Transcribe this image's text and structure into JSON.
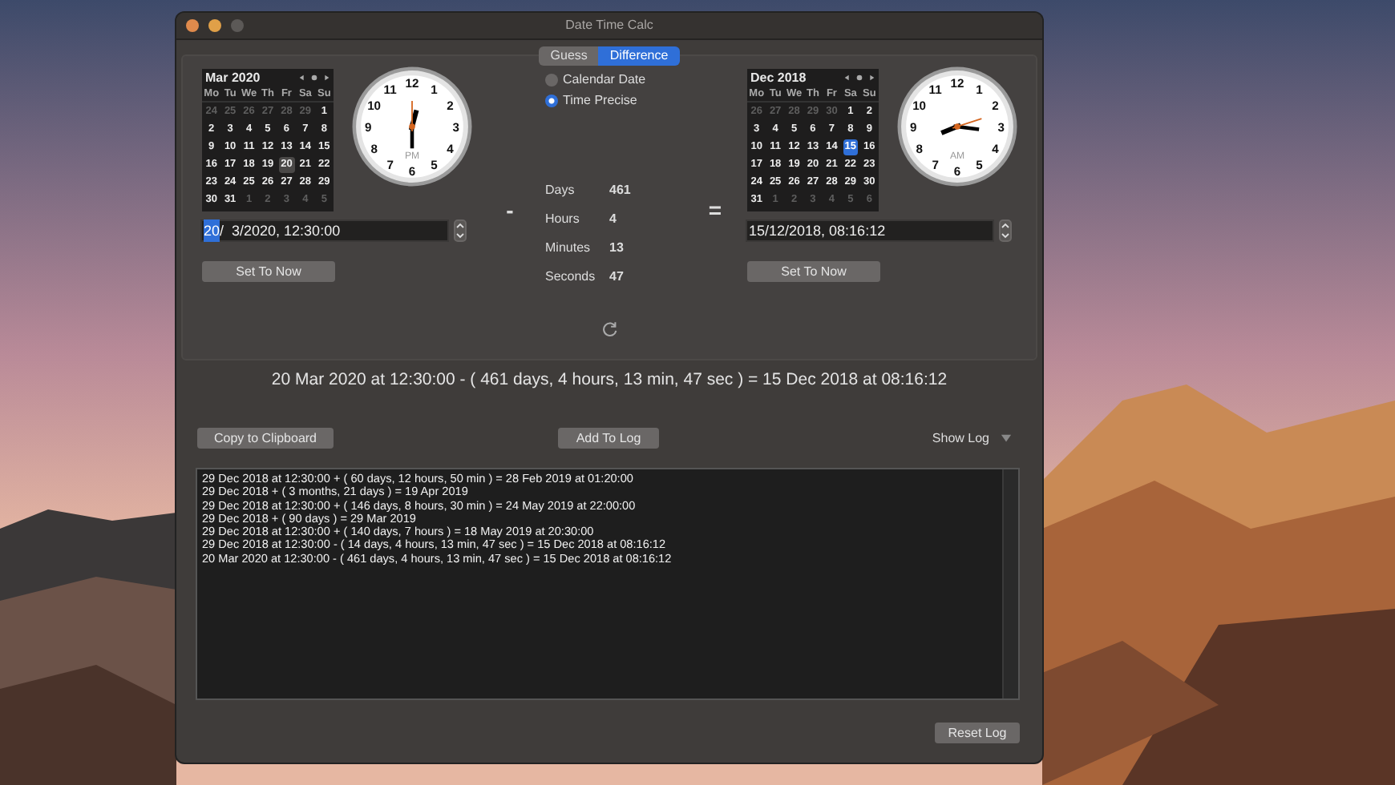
{
  "window": {
    "title": "Date Time Calc",
    "controls": [
      {
        "kind": "close",
        "disabled": false
      },
      {
        "kind": "minimize",
        "disabled": false
      },
      {
        "kind": "zoom",
        "disabled": true
      }
    ]
  },
  "tabs": [
    {
      "label": "Guess",
      "selected": false
    },
    {
      "label": "Difference",
      "selected": true
    }
  ],
  "dates": [
    {
      "calendar": {
        "title": "Mar 2020",
        "focused": false,
        "weekdays": [
          "Mo",
          "Tu",
          "We",
          "Th",
          "Fr",
          "Sa",
          "Su"
        ],
        "weeks": [
          [
            {
              "label": "24",
              "outside": true,
              "selected": false
            },
            {
              "label": "25",
              "outside": true,
              "selected": false
            },
            {
              "label": "26",
              "outside": true,
              "selected": false
            },
            {
              "label": "27",
              "outside": true,
              "selected": false
            },
            {
              "label": "28",
              "outside": true,
              "selected": false
            },
            {
              "label": "29",
              "outside": true,
              "selected": false
            },
            {
              "label": "1",
              "outside": false,
              "selected": false
            }
          ],
          [
            {
              "label": "2",
              "outside": false,
              "selected": false
            },
            {
              "label": "3",
              "outside": false,
              "selected": false
            },
            {
              "label": "4",
              "outside": false,
              "selected": false
            },
            {
              "label": "5",
              "outside": false,
              "selected": false
            },
            {
              "label": "6",
              "outside": false,
              "selected": false
            },
            {
              "label": "7",
              "outside": false,
              "selected": false
            },
            {
              "label": "8",
              "outside": false,
              "selected": false
            }
          ],
          [
            {
              "label": "9",
              "outside": false,
              "selected": false
            },
            {
              "label": "10",
              "outside": false,
              "selected": false
            },
            {
              "label": "11",
              "outside": false,
              "selected": false
            },
            {
              "label": "12",
              "outside": false,
              "selected": false
            },
            {
              "label": "13",
              "outside": false,
              "selected": false
            },
            {
              "label": "14",
              "outside": false,
              "selected": false
            },
            {
              "label": "15",
              "outside": false,
              "selected": false
            }
          ],
          [
            {
              "label": "16",
              "outside": false,
              "selected": false
            },
            {
              "label": "17",
              "outside": false,
              "selected": false
            },
            {
              "label": "18",
              "outside": false,
              "selected": false
            },
            {
              "label": "19",
              "outside": false,
              "selected": false
            },
            {
              "label": "20",
              "outside": false,
              "selected": true
            },
            {
              "label": "21",
              "outside": false,
              "selected": false
            },
            {
              "label": "22",
              "outside": false,
              "selected": false
            }
          ],
          [
            {
              "label": "23",
              "outside": false,
              "selected": false
            },
            {
              "label": "24",
              "outside": false,
              "selected": false
            },
            {
              "label": "25",
              "outside": false,
              "selected": false
            },
            {
              "label": "26",
              "outside": false,
              "selected": false
            },
            {
              "label": "27",
              "outside": false,
              "selected": false
            },
            {
              "label": "28",
              "outside": false,
              "selected": false
            },
            {
              "label": "29",
              "outside": false,
              "selected": false
            }
          ],
          [
            {
              "label": "30",
              "outside": false,
              "selected": false
            },
            {
              "label": "31",
              "outside": false,
              "selected": false
            },
            {
              "label": "1",
              "outside": true,
              "selected": false
            },
            {
              "label": "2",
              "outside": true,
              "selected": false
            },
            {
              "label": "3",
              "outside": true,
              "selected": false
            },
            {
              "label": "4",
              "outside": true,
              "selected": false
            },
            {
              "label": "5",
              "outside": true,
              "selected": false
            }
          ]
        ]
      },
      "clock": {
        "numerals": [
          "12",
          "11",
          "1",
          "10",
          "2",
          "9",
          "3",
          "8",
          "4",
          "7",
          "5",
          "6"
        ],
        "meridiem": "PM"
      },
      "field": {
        "segments": [
          {
            "text": "20",
            "selected": true
          },
          {
            "text": "/  3/2020, 12:30:00",
            "selected": false
          }
        ]
      },
      "button": "Set To Now"
    },
    {
      "calendar": {
        "title": "Dec 2018",
        "focused": true,
        "weekdays": [
          "Mo",
          "Tu",
          "We",
          "Th",
          "Fr",
          "Sa",
          "Su"
        ],
        "weeks": [
          [
            {
              "label": "26",
              "outside": true,
              "selected": false
            },
            {
              "label": "27",
              "outside": true,
              "selected": false
            },
            {
              "label": "28",
              "outside": true,
              "selected": false
            },
            {
              "label": "29",
              "outside": true,
              "selected": false
            },
            {
              "label": "30",
              "outside": true,
              "selected": false
            },
            {
              "label": "1",
              "outside": false,
              "selected": false
            },
            {
              "label": "2",
              "outside": false,
              "selected": false
            }
          ],
          [
            {
              "label": "3",
              "outside": false,
              "selected": false
            },
            {
              "label": "4",
              "outside": false,
              "selected": false
            },
            {
              "label": "5",
              "outside": false,
              "selected": false
            },
            {
              "label": "6",
              "outside": false,
              "selected": false
            },
            {
              "label": "7",
              "outside": false,
              "selected": false
            },
            {
              "label": "8",
              "outside": false,
              "selected": false
            },
            {
              "label": "9",
              "outside": false,
              "selected": false
            }
          ],
          [
            {
              "label": "10",
              "outside": false,
              "selected": false
            },
            {
              "label": "11",
              "outside": false,
              "selected": false
            },
            {
              "label": "12",
              "outside": false,
              "selected": false
            },
            {
              "label": "13",
              "outside": false,
              "selected": false
            },
            {
              "label": "14",
              "outside": false,
              "selected": false
            },
            {
              "label": "15",
              "outside": false,
              "selected": true
            },
            {
              "label": "16",
              "outside": false,
              "selected": false
            }
          ],
          [
            {
              "label": "17",
              "outside": false,
              "selected": false
            },
            {
              "label": "18",
              "outside": false,
              "selected": false
            },
            {
              "label": "19",
              "outside": false,
              "selected": false
            },
            {
              "label": "20",
              "outside": false,
              "selected": false
            },
            {
              "label": "21",
              "outside": false,
              "selected": false
            },
            {
              "label": "22",
              "outside": false,
              "selected": false
            },
            {
              "label": "23",
              "outside": false,
              "selected": false
            }
          ],
          [
            {
              "label": "24",
              "outside": false,
              "selected": false
            },
            {
              "label": "25",
              "outside": false,
              "selected": false
            },
            {
              "label": "26",
              "outside": false,
              "selected": false
            },
            {
              "label": "27",
              "outside": false,
              "selected": false
            },
            {
              "label": "28",
              "outside": false,
              "selected": false
            },
            {
              "label": "29",
              "outside": false,
              "selected": false
            },
            {
              "label": "30",
              "outside": false,
              "selected": false
            }
          ],
          [
            {
              "label": "31",
              "outside": false,
              "selected": false
            },
            {
              "label": "1",
              "outside": true,
              "selected": false
            },
            {
              "label": "2",
              "outside": true,
              "selected": false
            },
            {
              "label": "3",
              "outside": true,
              "selected": false
            },
            {
              "label": "4",
              "outside": true,
              "selected": false
            },
            {
              "label": "5",
              "outside": true,
              "selected": false
            },
            {
              "label": "6",
              "outside": true,
              "selected": false
            }
          ]
        ]
      },
      "clock": {
        "numerals": [
          "12",
          "11",
          "1",
          "10",
          "2",
          "9",
          "3",
          "8",
          "4",
          "7",
          "5",
          "6"
        ],
        "meridiem": "AM"
      },
      "field": {
        "segments": [
          {
            "text": "15/12/2018, 08:16:12",
            "selected": false
          }
        ]
      },
      "button": "Set To Now"
    }
  ],
  "modes": [
    {
      "label": "Calendar Date",
      "selected": false
    },
    {
      "label": "Time Precise",
      "selected": true
    }
  ],
  "operator": "-",
  "equals": "=",
  "difference": [
    {
      "label": "Days",
      "value": "461"
    },
    {
      "label": "Hours",
      "value": "4"
    },
    {
      "label": "Minutes",
      "value": "13"
    },
    {
      "label": "Seconds",
      "value": "47"
    }
  ],
  "result": "20 Mar 2020 at 12:30:00 - ( 461 days, 4 hours, 13 min, 47 sec ) = 15 Dec 2018 at 08:16:12",
  "copy_button": "Copy to Clipboard",
  "add_button": "Add To Log",
  "show_log": {
    "label": "Show Log",
    "expanded": true
  },
  "log": [
    "29 Dec 2018 at 12:30:00 + ( 60 days, 12 hours, 50 min ) = 28 Feb 2019 at 01:20:00",
    "29 Dec 2018 + ( 3 months, 21 days ) = 19 Apr 2019",
    "29 Dec 2018 at 12:30:00 + ( 146 days, 8 hours, 30 min ) = 24 May 2019 at 22:00:00",
    "29 Dec 2018 + ( 90 days ) = 29 Mar 2019",
    "29 Dec 2018 at 12:30:00 + ( 140 days, 7 hours ) = 18 May 2019 at 20:30:00",
    "29 Dec 2018 at 12:30:00 - ( 14 days, 4 hours, 13 min, 47 sec ) = 15 Dec 2018 at 08:16:12",
    "20 Mar 2020 at 12:30:00 - ( 461 days, 4 hours, 13 min, 47 sec ) = 15 Dec 2018 at 08:16:12"
  ],
  "reset_button": "Reset Log"
}
